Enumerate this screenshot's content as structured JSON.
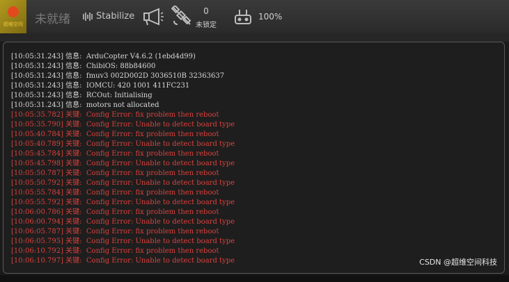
{
  "toolbar": {
    "logo_text": "超维空间",
    "status": "未就绪",
    "flight_mode": "Stabilize",
    "gps_count": "0",
    "gps_lock": "未锁定",
    "rc_signal": "100%"
  },
  "console": {
    "lines": [
      {
        "time": "[10:05:31.243]",
        "level": "信息:",
        "text": "ArduCopter V4.6.2 (1ebd4d99)",
        "type": "info"
      },
      {
        "time": "[10:05:31.243]",
        "level": "信息:",
        "text": "ChibiOS: 88b84600",
        "type": "info"
      },
      {
        "time": "[10:05:31.243]",
        "level": "信息:",
        "text": "fmuv3 002D002D 3036510B 32363637",
        "type": "info"
      },
      {
        "time": "[10:05:31.243]",
        "level": "信息:",
        "text": "IOMCU: 420 1001 411FC231",
        "type": "info"
      },
      {
        "time": "[10:05:31.243]",
        "level": "信息:",
        "text": "RCOut: Initialising",
        "type": "info"
      },
      {
        "time": "[10:05:31.243]",
        "level": "信息:",
        "text": "motors not allocated",
        "type": "info"
      },
      {
        "time": "[10:05:35.782]",
        "level": "关键:",
        "text": "Config Error: fix problem then reboot",
        "type": "crit"
      },
      {
        "time": "[10:05:35.790]",
        "level": "关键:",
        "text": "Config Error: Unable to detect board type",
        "type": "crit"
      },
      {
        "time": "[10:05:40.784]",
        "level": "关键:",
        "text": "Config Error: fix problem then reboot",
        "type": "crit"
      },
      {
        "time": "[10:05:40.789]",
        "level": "关键:",
        "text": "Config Error: Unable to detect board type",
        "type": "crit"
      },
      {
        "time": "[10:05:45.784]",
        "level": "关键:",
        "text": "Config Error: fix problem then reboot",
        "type": "crit"
      },
      {
        "time": "[10:05:45.798]",
        "level": "关键:",
        "text": "Config Error: Unable to detect board type",
        "type": "crit"
      },
      {
        "time": "[10:05:50.787]",
        "level": "关键:",
        "text": "Config Error: fix problem then reboot",
        "type": "crit"
      },
      {
        "time": "[10:05:50.792]",
        "level": "关键:",
        "text": "Config Error: Unable to detect board type",
        "type": "crit"
      },
      {
        "time": "[10:05:55.784]",
        "level": "关键:",
        "text": "Config Error: fix problem then reboot",
        "type": "crit"
      },
      {
        "time": "[10:05:55.792]",
        "level": "关键:",
        "text": "Config Error: Unable to detect board type",
        "type": "crit"
      },
      {
        "time": "[10:06:00.786]",
        "level": "关键:",
        "text": "Config Error: fix problem then reboot",
        "type": "crit"
      },
      {
        "time": "[10:06:00.794]",
        "level": "关键:",
        "text": "Config Error: Unable to detect board type",
        "type": "crit"
      },
      {
        "time": "[10:06:05.787]",
        "level": "关键:",
        "text": "Config Error: fix problem then reboot",
        "type": "crit"
      },
      {
        "time": "[10:06:05.795]",
        "level": "关键:",
        "text": "Config Error: Unable to detect board type",
        "type": "crit"
      },
      {
        "time": "[10:06:10.792]",
        "level": "关键:",
        "text": "Config Error: fix problem then reboot",
        "type": "crit"
      },
      {
        "time": "[10:06:10.797]",
        "level": "关键:",
        "text": "Config Error: Unable to detect board type",
        "type": "crit"
      }
    ]
  },
  "watermark": "CSDN @超维空间科技",
  "colors": {
    "toolbar_bg": "#2f2f2f",
    "info_text": "#d8d8d8",
    "critical_text": "#d9413c",
    "console_border": "#5a5a5a"
  },
  "icons": {
    "mode": "waveform-icon",
    "messages": "megaphone-icon",
    "gps": "satellite-icon",
    "rc": "rc-transmitter-icon"
  }
}
